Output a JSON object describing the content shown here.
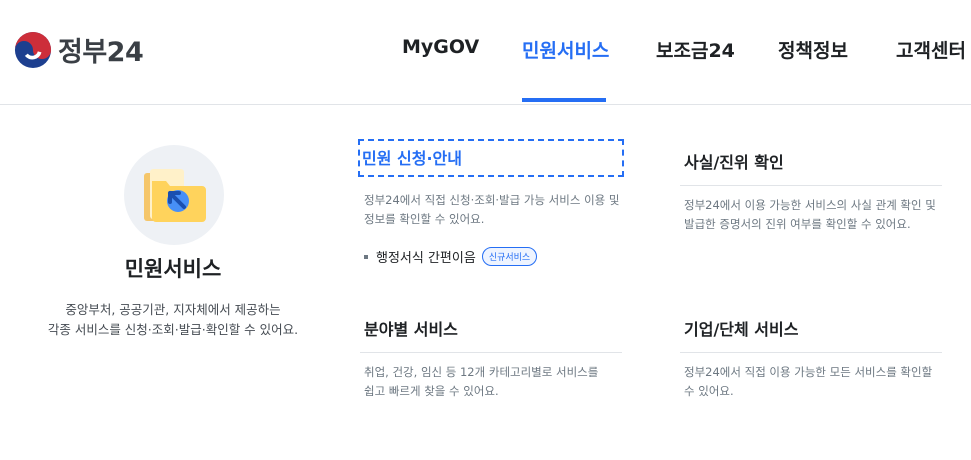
{
  "header": {
    "logo_text": "정부24",
    "nav": [
      {
        "label": "MyGOV"
      },
      {
        "label": "민원서비스"
      },
      {
        "label": "보조금24"
      },
      {
        "label": "정책정보"
      },
      {
        "label": "고객센터"
      }
    ],
    "active_index": 1
  },
  "hero": {
    "icon": "folder-arrow-icon",
    "title": "민원서비스",
    "desc_line1": "중앙부처, 공공기관, 지자체에서 제공하는",
    "desc_line2": "각종 서비스를 신청·조회·발급·확인할 수 있어요."
  },
  "cards": [
    {
      "title": "민원 신청·안내",
      "desc_line1": "정부24에서 직접 신청·조회·발급 가능 서비스 이용 및",
      "desc_line2": "정보를 확인할 수 있어요.",
      "link": "행정서식 간편이음",
      "badge": "신규서비스"
    },
    {
      "title": "사실/진위 확인",
      "desc_line1": "정부24에서 이용 가능한 서비스의 사실 관계 확인 및",
      "desc_line2": "발급한 증명서의 진위 여부를 확인할 수 있어요."
    },
    {
      "title": "분야별 서비스",
      "desc_line1": "취업, 건강, 임신 등 12개 카테고리별로 서비스를",
      "desc_line2": "쉽고 빠르게 찾을 수 있어요."
    },
    {
      "title": "기업/단체 서비스",
      "desc_line1": "정부24에서 직접 이용 가능한 모든 서비스를 확인할",
      "desc_line2": "수 있어요."
    }
  ],
  "colors": {
    "accent": "#256ef4",
    "text": "#1e2124",
    "muted": "#6d7882",
    "divider": "#e1e4e8"
  }
}
